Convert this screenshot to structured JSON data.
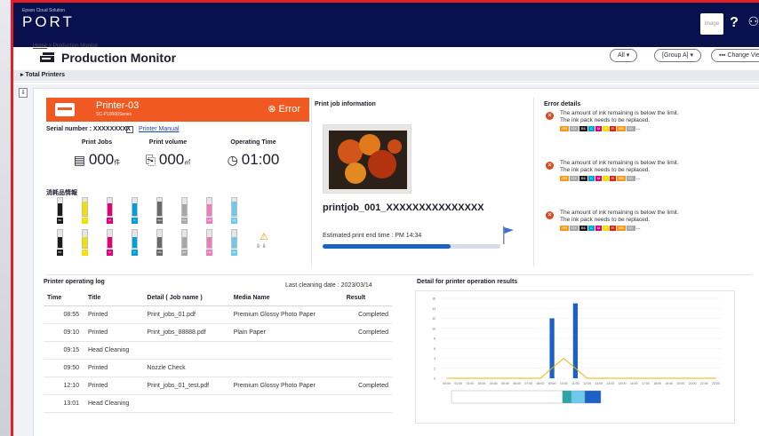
{
  "app": {
    "brand_small": "Epson Cloud Solution",
    "brand": "PORT",
    "image_chip": "image"
  },
  "breadcrumb": {
    "home": "Home",
    "separator": ">",
    "current": "Production Monitor"
  },
  "page": {
    "title": "Production Monitor",
    "total_printers": "▸ Total Printers"
  },
  "filters": {
    "all": "All ▾",
    "group": "[Group A] ▾",
    "change_view": "▪▪▪ Change View"
  },
  "printer": {
    "name": "Printer-03",
    "model": "SC-P10000Series",
    "status": "Error",
    "serial_label": "Serial number : XXXXXXXXX",
    "manual_link": "Printer Manual"
  },
  "stats": [
    {
      "label": "Print Jobs",
      "value": "000",
      "unit": "件",
      "icon": "document-icon"
    },
    {
      "label": "Print volume",
      "value": "000",
      "unit": "㎡",
      "icon": "sheet-icon"
    },
    {
      "label": "Operating Time",
      "value": "01:00",
      "unit": "",
      "icon": "clock-icon"
    }
  ],
  "consumables": {
    "label": "消耗品情報",
    "row1": [
      {
        "code": "BK",
        "color": "#1c1c1c",
        "level": 0.7
      },
      {
        "code": "Y",
        "color": "#f2e000",
        "level": 0.8
      },
      {
        "code": "M",
        "color": "#e2007a",
        "level": 0.7
      },
      {
        "code": "C",
        "color": "#00a0e0",
        "level": 0.7
      },
      {
        "code": "OG",
        "color": "#6a6a6a",
        "level": 0.8
      },
      {
        "code": "GY",
        "color": "#a8a8a8",
        "level": 0.65
      },
      {
        "code": "LM",
        "color": "#f07abc",
        "level": 0.65
      },
      {
        "code": "LC",
        "color": "#6fc9ee",
        "level": 0.8
      }
    ],
    "row2": [
      {
        "code": "BK",
        "color": "#1c1c1c",
        "level": 0.6
      },
      {
        "code": "Y",
        "color": "#f2e000",
        "level": 0.6
      },
      {
        "code": "M",
        "color": "#e2007a",
        "level": 0.6
      },
      {
        "code": "C",
        "color": "#00a0e0",
        "level": 0.6
      },
      {
        "code": "OG",
        "color": "#6a6a6a",
        "level": 0.6
      },
      {
        "code": "GY",
        "color": "#a8a8a8",
        "level": 0.6
      },
      {
        "code": "LM",
        "color": "#f07abc",
        "level": 0.6
      },
      {
        "code": "LC",
        "color": "#6fc9ee",
        "level": 0.6
      }
    ],
    "maintenance_icons": [
      "warning-icon",
      "download-icon"
    ]
  },
  "job": {
    "section": "Print job information",
    "name": "printjob_001_XXXXXXXXXXXXXXX",
    "end_time": "Estimated print end time : PM 14:34",
    "progress": 0.72
  },
  "errors": {
    "section": "Error details",
    "items": [
      {
        "line1": "The amount of ink remaining is below the limit.",
        "line2": "The ink pack needs to be replaced."
      },
      {
        "line1": "The amount of ink remaining is below the limit.",
        "line2": "The ink pack needs to be replaced."
      },
      {
        "line1": "The amount of ink remaining is below the limit.",
        "line2": "The ink pack needs to be replaced."
      }
    ],
    "tags": [
      {
        "t": "OR",
        "c": "#f39a1a"
      },
      {
        "t": "GY",
        "c": "#a8a8a8"
      },
      {
        "t": "BK",
        "c": "#1c1c1c"
      },
      {
        "t": "C",
        "c": "#00a0e0"
      },
      {
        "t": "M",
        "c": "#e2007a"
      },
      {
        "t": "Y",
        "c": "#f2e000"
      },
      {
        "t": "R",
        "c": "#e3221a"
      },
      {
        "t": "OR",
        "c": "#f39a1a"
      },
      {
        "t": "GY",
        "c": "#a8a8a8"
      }
    ],
    "more": "..."
  },
  "log": {
    "title": "Printer operating log",
    "cleaning_date": "Last cleaning date : 2023/03/14",
    "headers": [
      "Time",
      "Title",
      "Detail ( Job name )",
      "Media Name",
      "Result"
    ],
    "rows": [
      [
        "08:55",
        "Printed",
        "Print_jobs_01.pdf",
        "Premium Glossy Photo Paper",
        "Completed"
      ],
      [
        "09:10",
        "Printed",
        "Print_jobs_88888.pdf",
        "Plain Paper",
        "Completed"
      ],
      [
        "09:15",
        "Head Cleaning",
        "",
        "",
        ""
      ],
      [
        "09:50",
        "Printed",
        "Nozzle Check",
        "",
        ""
      ],
      [
        "12:10",
        "Printed",
        "Print_jobs_01_test.pdf",
        "Premium Glossy Photo Paper",
        "Completed"
      ],
      [
        "13:01",
        "Head Cleaning",
        "",
        "",
        ""
      ]
    ]
  },
  "chart_data": {
    "type": "bar",
    "title": "Detail for printer operation results",
    "categories": [
      "00:00",
      "01:00",
      "02:00",
      "03:00",
      "04:00",
      "05:00",
      "06:00",
      "07:00",
      "08:00",
      "09:00",
      "10:00",
      "11:00",
      "12:00",
      "13:00",
      "14:00",
      "15:00",
      "16:00",
      "17:00",
      "18:00",
      "19:00",
      "20:00",
      "21:00",
      "22:00",
      "23:00"
    ],
    "series": [
      {
        "values": [
          0,
          0,
          0,
          0,
          0,
          0,
          0,
          0,
          0,
          12,
          0,
          15,
          0,
          0,
          0,
          0,
          0,
          0,
          0,
          0,
          0,
          0,
          0,
          0
        ],
        "color": "#1c62c4"
      },
      {
        "values": [
          0,
          0,
          0,
          0,
          0,
          0,
          0,
          0,
          0,
          2,
          4,
          2,
          0,
          0,
          0,
          0,
          0,
          0,
          0,
          0,
          0,
          0,
          0,
          0
        ],
        "color": "#f2b300"
      }
    ],
    "yticks": [
      "0",
      "2",
      "4",
      "6",
      "8",
      "10",
      "12",
      "14",
      "16"
    ],
    "ylim": [
      0,
      16
    ],
    "timeline_colors": [
      "#ffffff",
      "#2aa6a6",
      "#6fc9ee",
      "#1c62c4"
    ]
  }
}
